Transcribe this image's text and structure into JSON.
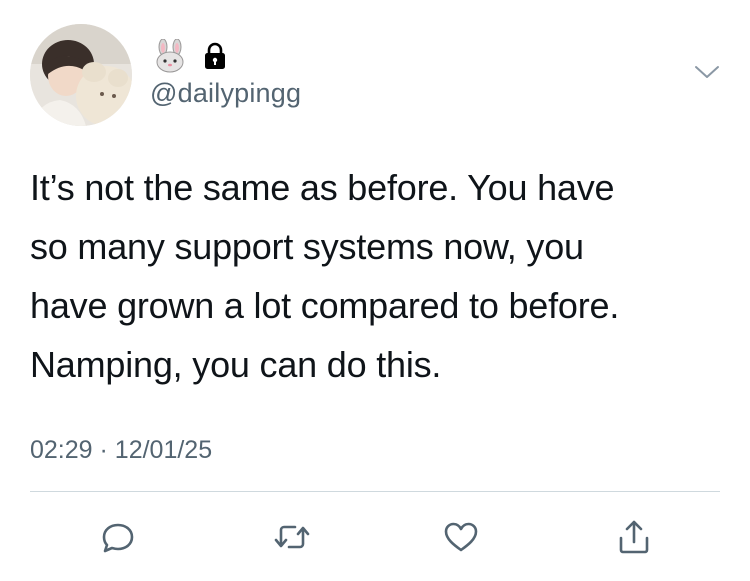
{
  "user": {
    "name_emojis": [
      "bunny-emoji",
      "lock-icon"
    ],
    "handle": "@dailypingg"
  },
  "tweet": {
    "text": "It’s not the same as before. You have\nso many support systems now, you\nhave grown a lot compared to before.\nNamping, you can do this.",
    "time": "02:29",
    "separator": "·",
    "date": "12/01/25"
  },
  "actions": [
    {
      "icon": "reply-icon"
    },
    {
      "icon": "retweet-icon"
    },
    {
      "icon": "like-icon"
    },
    {
      "icon": "share-icon"
    }
  ],
  "colors": {
    "text": "#0f1419",
    "secondary": "#536471",
    "divider": "#cfd9de",
    "icon": "#536471"
  }
}
